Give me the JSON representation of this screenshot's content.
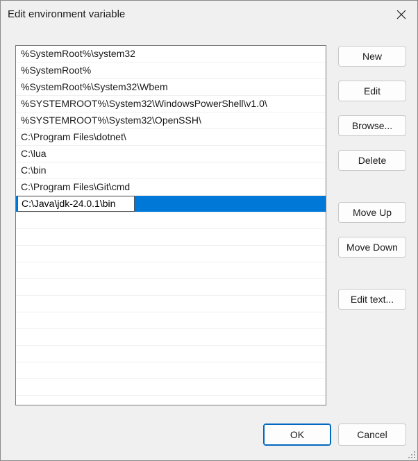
{
  "dialog": {
    "title": "Edit environment variable"
  },
  "entries": [
    "%SystemRoot%\\system32",
    "%SystemRoot%",
    "%SystemRoot%\\System32\\Wbem",
    "%SYSTEMROOT%\\System32\\WindowsPowerShell\\v1.0\\",
    "%SYSTEMROOT%\\System32\\OpenSSH\\",
    "C:\\Program Files\\dotnet\\",
    "C:\\lua",
    "C:\\bin",
    "C:\\Program Files\\Git\\cmd"
  ],
  "editing_entry": "C:\\Java\\jdk-24.0.1\\bin",
  "buttons": {
    "new": "New",
    "edit": "Edit",
    "browse": "Browse...",
    "delete": "Delete",
    "move_up": "Move Up",
    "move_down": "Move Down",
    "edit_text": "Edit text...",
    "ok": "OK",
    "cancel": "Cancel"
  },
  "icons": {
    "close": "close-icon",
    "resize_grip": "resize-grip-icon"
  },
  "colors": {
    "selection": "#0078d7",
    "accent_border": "#0067c0"
  }
}
